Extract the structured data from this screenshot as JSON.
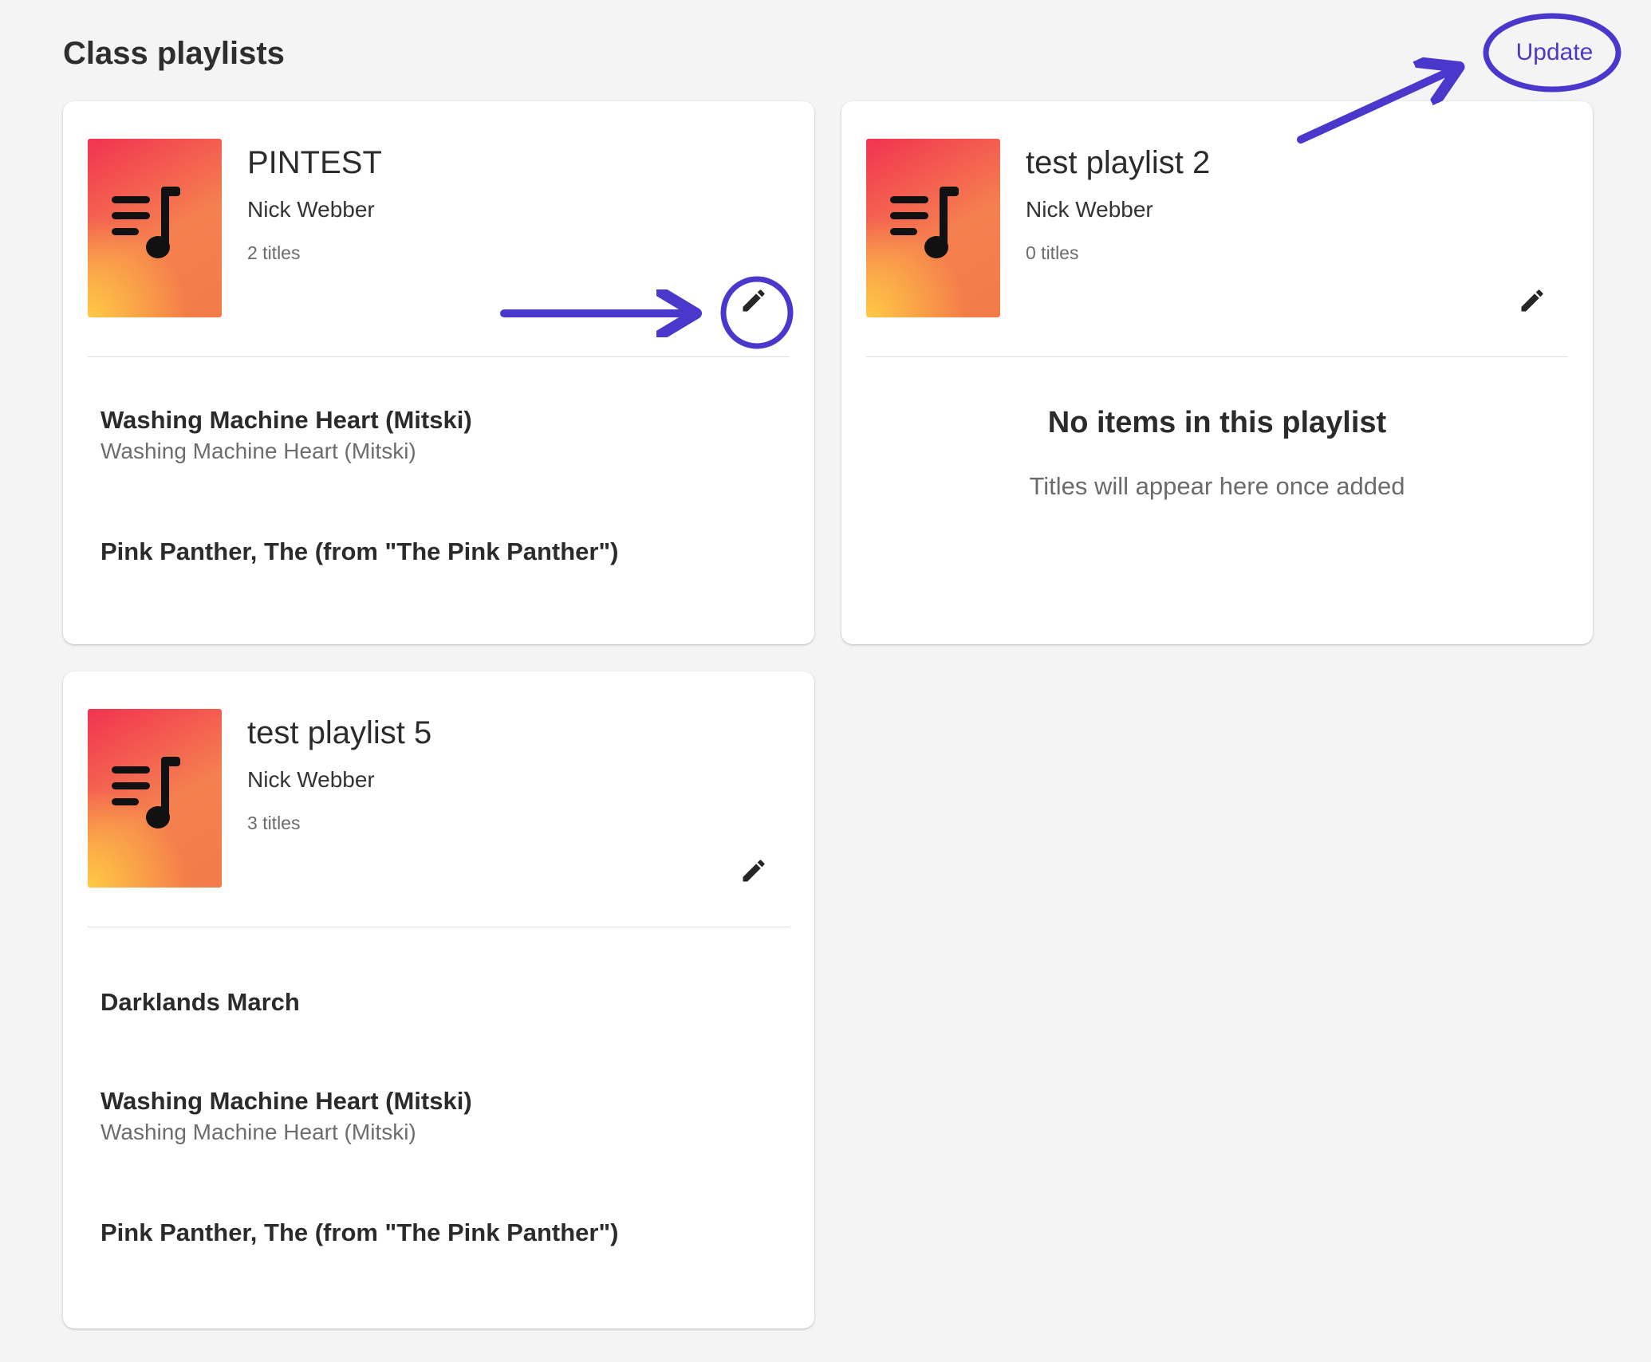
{
  "page": {
    "title": "Class playlists",
    "update_label": "Update"
  },
  "playlists": [
    {
      "title": "PINTEST",
      "owner": "Nick Webber",
      "count": "2 titles",
      "tracks": [
        {
          "title": "Washing Machine Heart (Mitski)",
          "subtitle": "Washing Machine Heart (Mitski)"
        },
        {
          "title": "Pink Panther, The (from \"The Pink Panther\")",
          "subtitle": ""
        }
      ]
    },
    {
      "title": "test playlist 2",
      "owner": "Nick Webber",
      "count": "0 titles",
      "empty_title": "No items in this playlist",
      "empty_subtitle": "Titles will appear here once added"
    },
    {
      "title": "test playlist 5",
      "owner": "Nick Webber",
      "count": "3 titles",
      "tracks": [
        {
          "title": "Darklands March",
          "subtitle": ""
        },
        {
          "title": "Washing Machine Heart (Mitski)",
          "subtitle": "Washing Machine Heart (Mitski)"
        },
        {
          "title": "Pink Panther, The (from \"The Pink Panther\")",
          "subtitle": ""
        }
      ]
    }
  ],
  "icons": {
    "cover": "playlist-music-icon",
    "edit": "pencil-icon"
  },
  "colors": {
    "accent": "#4d3ac7",
    "annotation": "#4a38cc",
    "cover_top": "#f23351",
    "cover_mid": "#f5804f",
    "cover_corner": "#ffca44"
  }
}
